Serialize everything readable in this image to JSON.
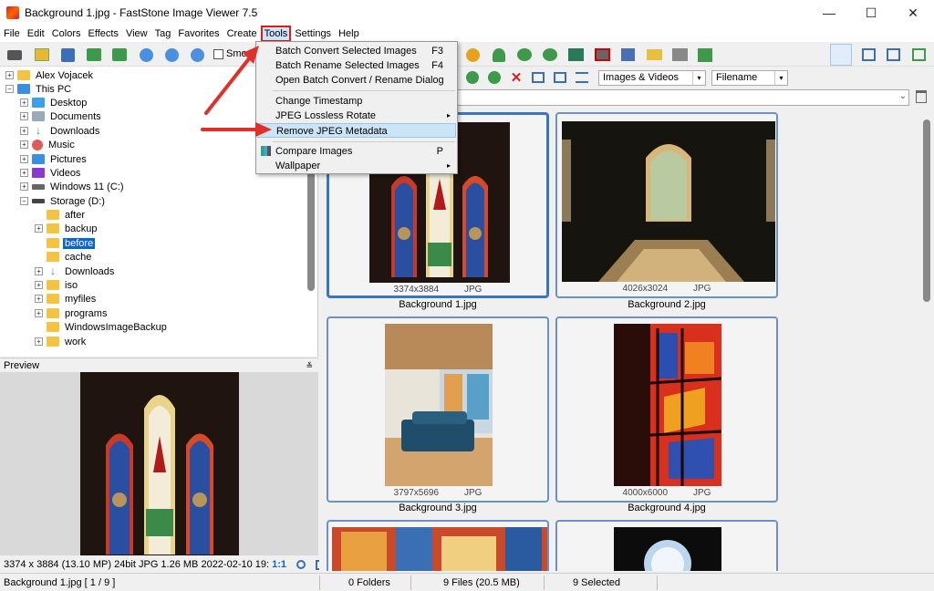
{
  "window": {
    "title": "Background 1.jpg  -  FastStone Image Viewer 7.5",
    "minimize": "—",
    "maximize": "☐",
    "close": "✕"
  },
  "menu": [
    "File",
    "Edit",
    "Colors",
    "Effects",
    "View",
    "Tag",
    "Favorites",
    "Create",
    "Tools",
    "Settings",
    "Help"
  ],
  "toolbar": {
    "smooth_label": "Smo"
  },
  "tools_menu": {
    "items": [
      {
        "label": "Batch Convert Selected Images",
        "shortcut": "F3"
      },
      {
        "label": "Batch Rename Selected Images",
        "shortcut": "F4"
      },
      {
        "label": "Open Batch Convert / Rename Dialog",
        "shortcut": ""
      },
      {
        "label": "Change Timestamp",
        "shortcut": ""
      },
      {
        "label": "JPEG Lossless Rotate",
        "shortcut": "",
        "submenu": true
      },
      {
        "label": "Remove JPEG Metadata",
        "shortcut": "",
        "highlighted": true
      },
      {
        "label": "Compare Images",
        "shortcut": "P"
      },
      {
        "label": "Wallpaper",
        "shortcut": "",
        "submenu": true
      }
    ],
    "submenu_arrow": "▸"
  },
  "tree": {
    "expand_glyph": "+",
    "collapse_glyph": "−",
    "items": [
      {
        "label": "Alex Vojacek"
      },
      {
        "label": "This PC"
      },
      {
        "label": "Desktop"
      },
      {
        "label": "Documents"
      },
      {
        "label": "Downloads"
      },
      {
        "label": "Music"
      },
      {
        "label": "Pictures"
      },
      {
        "label": "Videos"
      },
      {
        "label": "Windows 11 (C:)"
      },
      {
        "label": "Storage (D:)"
      },
      {
        "label": "after"
      },
      {
        "label": "backup"
      },
      {
        "label": "before",
        "selected": true
      },
      {
        "label": "cache"
      },
      {
        "label": "Downloads"
      },
      {
        "label": "iso"
      },
      {
        "label": "myfiles"
      },
      {
        "label": "programs"
      },
      {
        "label": "WindowsImageBackup"
      },
      {
        "label": "work"
      }
    ]
  },
  "preview": {
    "header": "Preview",
    "pin": "≚",
    "info_main": "3374 x 3884 (13.10 MP)  24bit  JPG   1.26 MB   2022-02-10 19:",
    "info_ratio": "1:1"
  },
  "filter": {
    "type": "Images & Videos",
    "sort": "Filename",
    "arrow": "▾"
  },
  "address": {
    "arrow": "⌄"
  },
  "thumbnails": [
    {
      "name": "Background 1.jpg",
      "dims": "3374x3884",
      "format": "JPG",
      "selected": true
    },
    {
      "name": "Background 2.jpg",
      "dims": "4026x3024",
      "format": "JPG"
    },
    {
      "name": "Background 3.jpg",
      "dims": "3797x5696",
      "format": "JPG"
    },
    {
      "name": "Background 4.jpg",
      "dims": "4000x6000",
      "format": "JPG"
    }
  ],
  "status": {
    "file": "Background 1.jpg [ 1 / 9 ]",
    "folders": "0 Folders",
    "files": "9 Files (20.5 MB)",
    "selected": "9 Selected"
  },
  "colors": {
    "accent": "#0a64d2",
    "highlight": "#cce4f7",
    "arrow": "#e0302c",
    "card_border": "#6b92c8"
  }
}
